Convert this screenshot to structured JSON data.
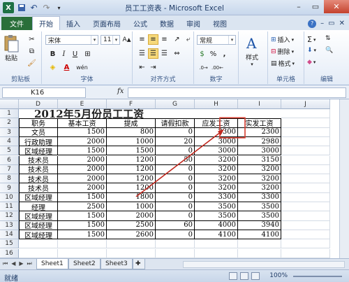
{
  "window": {
    "title": "员工工资表 - Microsoft Excel",
    "qat_undo": "↶",
    "qat_redo": "↷"
  },
  "tabs": [
    "文件",
    "开始",
    "插入",
    "页面布局",
    "公式",
    "数据",
    "审阅",
    "视图"
  ],
  "ribbon": {
    "paste": "粘贴",
    "clipboard": "剪贴板",
    "font_name": "宋体",
    "font_size": "11",
    "font_group": "字体",
    "align_group": "对齐方式",
    "number_format": "常规",
    "number_group": "数字",
    "styles": "样式",
    "insert": "插入",
    "delete": "删除",
    "format": "格式",
    "cells_group": "单元格",
    "edit_group": "编辑"
  },
  "formula_bar": {
    "name_box": "K16",
    "fx": "fx",
    "content": ""
  },
  "columns": [
    "D",
    "E",
    "F",
    "G",
    "H",
    "I",
    "J"
  ],
  "rows": [
    "1",
    "2",
    "3",
    "4",
    "5",
    "6",
    "7",
    "8",
    "9",
    "10",
    "11",
    "12",
    "13",
    "14",
    "15",
    "16"
  ],
  "sheet": {
    "title": "2012年5月份员工工资",
    "headers": [
      "职务",
      "基本工资",
      "提成",
      "请假扣款",
      "应发工资",
      "实发工资"
    ],
    "data": [
      [
        "文员",
        "1500",
        "800",
        "0",
        "2300",
        "2300"
      ],
      [
        "行政助理",
        "2000",
        "1000",
        "20",
        "3000",
        "2980"
      ],
      [
        "区域经理",
        "1500",
        "1500",
        "0",
        "3000",
        "3000"
      ],
      [
        "技术员",
        "2000",
        "1200",
        "50",
        "3200",
        "3150"
      ],
      [
        "技术员",
        "2000",
        "1200",
        "0",
        "3200",
        "3200"
      ],
      [
        "技术员",
        "2000",
        "1200",
        "0",
        "3200",
        "3200"
      ],
      [
        "技术员",
        "2000",
        "1200",
        "0",
        "3200",
        "3200"
      ],
      [
        "区域经理",
        "1500",
        "1800",
        "0",
        "3300",
        "3300"
      ],
      [
        "经理",
        "2500",
        "1000",
        "0",
        "3500",
        "3500"
      ],
      [
        "区域经理",
        "1500",
        "2000",
        "0",
        "3500",
        "3500"
      ],
      [
        "区域经理",
        "1500",
        "2500",
        "60",
        "4000",
        "3940"
      ],
      [
        "区域经理",
        "1500",
        "2600",
        "0",
        "4100",
        "4100"
      ]
    ]
  },
  "sheet_tabs": [
    "Sheet1",
    "Sheet2",
    "Sheet3"
  ],
  "status": {
    "ready": "就绪",
    "zoom": "100%"
  },
  "colors": {
    "highlight_box": "#d63c2f",
    "arrow": "#c0281e",
    "file_tab": "#2a6f3a"
  }
}
